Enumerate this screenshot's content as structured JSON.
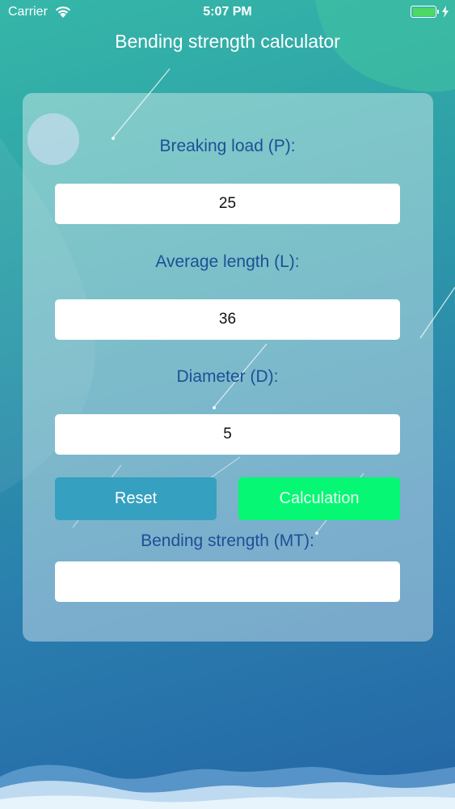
{
  "status_bar": {
    "carrier": "Carrier",
    "time": "5:07 PM"
  },
  "nav": {
    "title": "Bending strength calculator"
  },
  "form": {
    "breaking_load": {
      "label": "Breaking load (P):",
      "value": "25"
    },
    "average_length": {
      "label": "Average length (L):",
      "value": "36"
    },
    "diameter": {
      "label": "Diameter (D):",
      "value": "5"
    },
    "reset_label": "Reset",
    "calculation_label": "Calculation",
    "result": {
      "label": "Bending strength (MT):",
      "value": ""
    }
  },
  "colors": {
    "label_text": "#1e4f96",
    "reset_button": "#36a0c0",
    "calculation_button": "#06f774",
    "battery_fill": "#4cd964"
  }
}
